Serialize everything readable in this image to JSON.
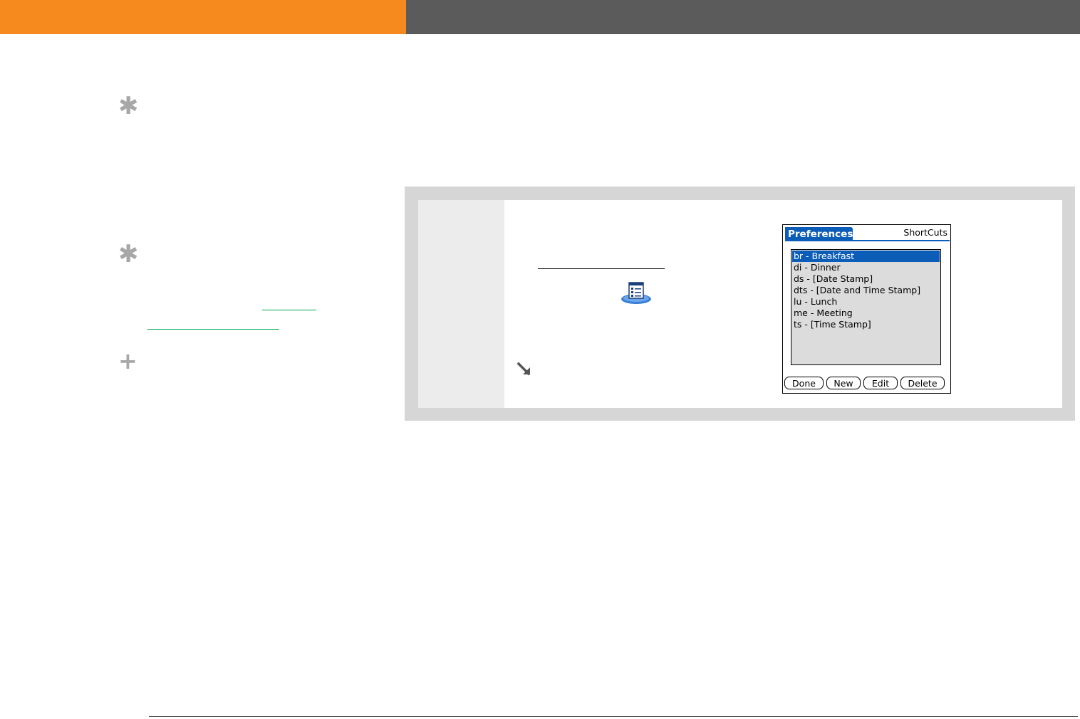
{
  "sidebar": {
    "markers": [
      "✱",
      "✱",
      "+"
    ]
  },
  "screen": {
    "tab_title": "Preferences",
    "app_name": "ShortCuts",
    "list": [
      "br - Breakfast",
      "di - Dinner",
      "ds - [Date Stamp]",
      "dts - [Date and Time Stamp]",
      "lu - Lunch",
      "me - Meeting",
      "ts - [Time Stamp]"
    ],
    "selected_index": 0,
    "buttons": [
      "Done",
      "New",
      "Edit",
      "Delete"
    ]
  },
  "colors": {
    "top_bar_left": "#f68a1f",
    "top_bar_right": "#5b5b5b",
    "palm_accent": "#0b5db8",
    "link": "#00a651"
  },
  "icons": {
    "app_icon": "preferences-app-icon",
    "tip": "arrow-down-right-icon"
  }
}
